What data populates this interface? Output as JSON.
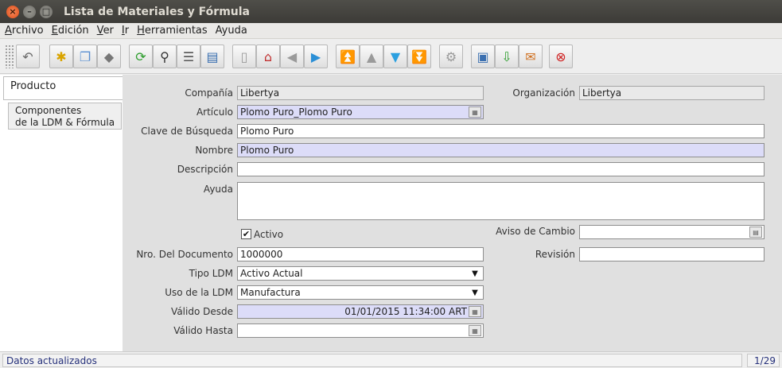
{
  "window": {
    "title": "Lista de Materiales y Fórmula"
  },
  "menu": [
    {
      "u": "A",
      "rest": "rchivo"
    },
    {
      "u": "E",
      "rest": "dición"
    },
    {
      "u": "V",
      "rest": "er"
    },
    {
      "u": "I",
      "rest": "r"
    },
    {
      "u": "H",
      "rest": "erramientas"
    },
    {
      "u": "",
      "rest": "Ayuda"
    }
  ],
  "toolbar": {
    "buttons": [
      "undo-icon",
      "new-record-icon",
      "copy-record-icon",
      "delete-record-icon",
      "refresh-icon",
      "find-icon",
      "report-icon",
      "attachment-icon",
      "history-icon",
      "home-icon",
      "previous-icon",
      "next-icon",
      "first-record-icon",
      "previous-record-icon",
      "next-record-icon",
      "last-record-icon",
      "settings-icon",
      "print-icon",
      "export-icon",
      "chat-icon",
      "close-icon"
    ]
  },
  "tabs": {
    "producto": "Producto",
    "componentes_line1": "Componentes",
    "componentes_line2": "de la LDM & Fórmula"
  },
  "form": {
    "compania_label": "Compañía",
    "compania_value": "Libertya",
    "organizacion_label": "Organización",
    "organizacion_value": "Libertya",
    "articulo_label": "Artículo",
    "articulo_value": "Plomo Puro_Plomo Puro",
    "clave_label": "Clave de Búsqueda",
    "clave_value": "Plomo Puro",
    "nombre_label": "Nombre",
    "nombre_value": "Plomo Puro",
    "descripcion_label": "Descripción",
    "descripcion_value": "",
    "ayuda_label": "Ayuda",
    "ayuda_value": "",
    "activo_label": "Activo",
    "activo_checked": true,
    "aviso_label": "Aviso de Cambio",
    "aviso_value": "",
    "nro_doc_label": "Nro. Del Documento",
    "nro_doc_value": "1000000",
    "revision_label": "Revisión",
    "revision_value": "",
    "tipo_ldm_label": "Tipo LDM",
    "tipo_ldm_value": "Activo Actual",
    "uso_ldm_label": "Uso de la LDM",
    "uso_ldm_value": "Manufactura",
    "valido_desde_label": "Válido Desde",
    "valido_desde_value": "01/01/2015 11:34:00 ART",
    "valido_hasta_label": "Válido Hasta",
    "valido_hasta_value": ""
  },
  "status": {
    "message": "Datos actualizados",
    "record_count": "1/29"
  }
}
